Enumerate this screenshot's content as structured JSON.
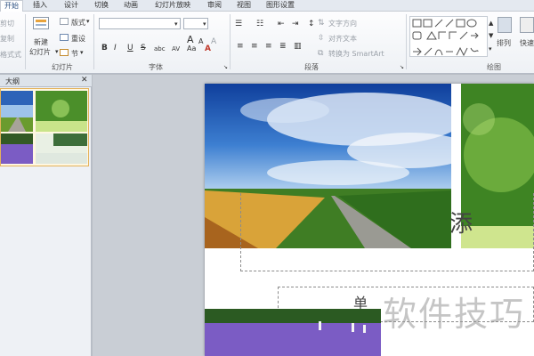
{
  "tabs": [
    "开始",
    "插入",
    "设计",
    "切换",
    "动画",
    "幻灯片放映",
    "审阅",
    "视图",
    "图形设置"
  ],
  "clipboard": {
    "cut": "剪切",
    "copy": "复制",
    "format": "格式式"
  },
  "slides_group": {
    "new_slide_line1": "新建",
    "new_slide_line2": "幻灯片",
    "layout": "版式",
    "reset": "重设",
    "section": "节",
    "label": "幻灯片"
  },
  "font_group": {
    "label": "字体",
    "bold": "B",
    "italic": "I",
    "underline": "U",
    "strike": "S",
    "shadow": "abc",
    "spacing": "AV",
    "case": "Aa",
    "grow": "A",
    "shrink": "A",
    "clear": "A"
  },
  "paragraph_group": {
    "label": "段落",
    "text_direction": "文字方向",
    "align_text": "对齐文本",
    "smartart": "转换为 SmartArt"
  },
  "drawing_group": {
    "label": "绘图",
    "arrange": "排列",
    "quick_styles": "快速样"
  },
  "outline": {
    "title": "大纲",
    "close": "✕",
    "slide_number": "1"
  },
  "slide": {
    "title_fragment": "添",
    "subtitle_fragment": "单"
  },
  "watermark": "软件技巧",
  "colors": {
    "tab_active_text": "#2b4f81",
    "thumb_border": "#e3b25a",
    "lavender": "#7b5cc4"
  }
}
